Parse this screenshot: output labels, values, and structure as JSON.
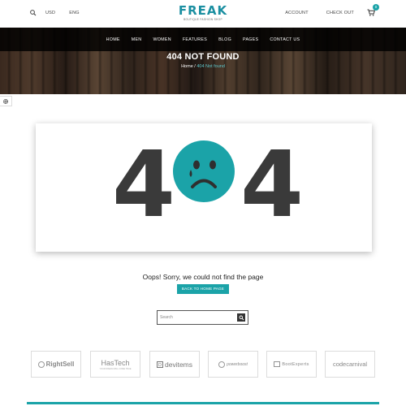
{
  "topbar": {
    "currency": "USD",
    "language": "ENG",
    "logo_word": "FREAK",
    "logo_tagline": "BOUTIQUE FASHION SHOP",
    "account_label": "ACCOUNT",
    "checkout_label": "CHECK OUT",
    "cart_count": "0",
    "icons": {
      "search": "search-icon",
      "cart": "cart-icon"
    }
  },
  "nav": {
    "items": [
      "HOME",
      "MEN",
      "WOMEN",
      "FEATURES",
      "BLOG",
      "PAGES",
      "CONTACT US"
    ]
  },
  "hero": {
    "title": "404 NOT FOUND",
    "breadcrumb_home": "Home",
    "breadcrumb_sep": " / ",
    "breadcrumb_current": "404 Not found"
  },
  "error": {
    "digit_left": "4",
    "digit_right": "4",
    "message": "Oops! Sorry, we could not find the page",
    "button_label": "BACK TO HOME PAGE"
  },
  "search": {
    "placeholder": "Search"
  },
  "brands": [
    "RightSell",
    "HasTech",
    "devitems",
    "powerboost",
    "BootExperts",
    "codecarnival"
  ],
  "hastech_tagline": "YOUR DREAM WILL COME TRUE",
  "colors": {
    "accent": "#1ba3a8",
    "logo": "#1b8fa1",
    "digits": "#3a3a3a",
    "nav_bg": "#000000"
  }
}
